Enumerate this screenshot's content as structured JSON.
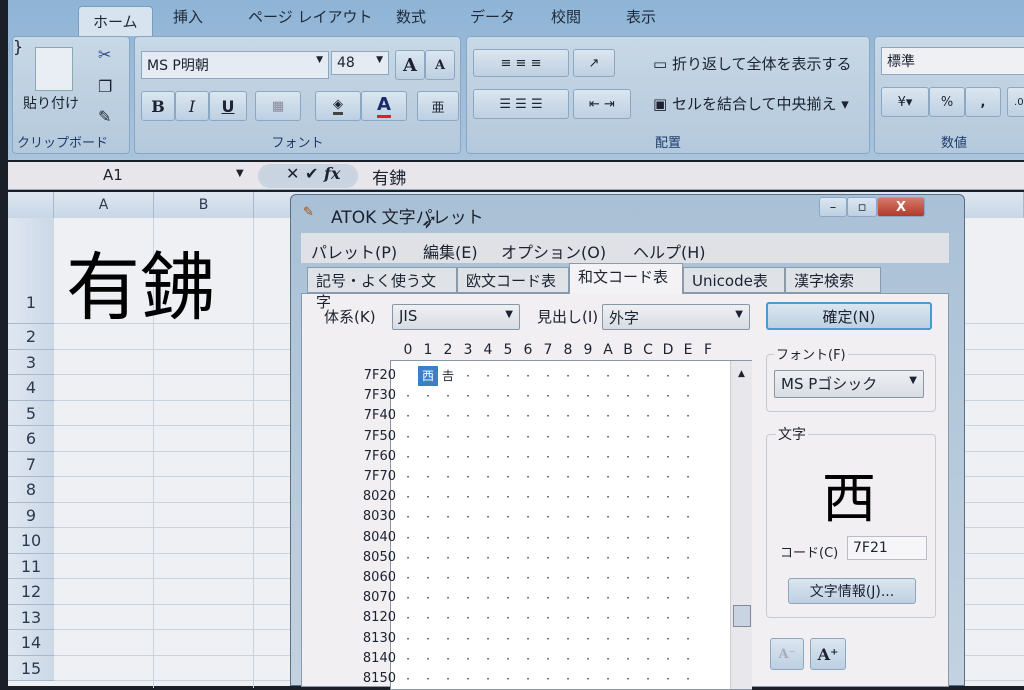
{
  "ribbon": {
    "tabs": [
      "ホーム",
      "挿入",
      "ページ レイアウト",
      "数式",
      "データ",
      "校閲",
      "表示"
    ],
    "clipboard": {
      "paste": "貼り付け",
      "label": "クリップボード"
    },
    "font": {
      "name": "MS P明朝",
      "size": "48",
      "label": "フォント",
      "bold": "B",
      "italic": "I",
      "underline": "U",
      "grow": "A",
      "shrink": "A",
      "color": "A",
      "phonetic": "亜"
    },
    "alignment": {
      "wrap": "折り返して全体を表示する",
      "merge": "セルを結合して中央揃え",
      "label": "配置"
    },
    "number": {
      "format": "標準",
      "percent": "%",
      "comma": ",",
      "label": "数値"
    }
  },
  "formula_bar": {
    "cell": "A1",
    "fx": "fx",
    "content": "有鉘"
  },
  "sheet": {
    "columns": [
      "A",
      "B"
    ],
    "rows": [
      "1",
      "2",
      "3",
      "4",
      "5",
      "6",
      "7",
      "8",
      "9",
      "10",
      "11",
      "12",
      "13",
      "14",
      "15"
    ],
    "a1": "有鉘"
  },
  "palette": {
    "title": "ATOK 文字パレット",
    "menus": [
      "パレット(P)",
      "編集(E)",
      "オプション(O)",
      "ヘルプ(H)"
    ],
    "tabs": [
      "記号・よく使う文字",
      "欧文コード表",
      "和文コード表",
      "Unicode表",
      "漢字検索"
    ],
    "system_label": "体系(K)",
    "system": "JIS",
    "heading_label": "見出し(I)",
    "heading": "外字",
    "ok": "確定(N)",
    "hex_cols": [
      "0",
      "1",
      "2",
      "3",
      "4",
      "5",
      "6",
      "7",
      "8",
      "9",
      "A",
      "B",
      "C",
      "D",
      "E",
      "F"
    ],
    "row_codes": [
      "7F20",
      "7F30",
      "7F40",
      "7F50",
      "7F60",
      "7F70",
      "8020",
      "8030",
      "8040",
      "8050",
      "8060",
      "8070",
      "8120",
      "8130",
      "8140",
      "8150"
    ],
    "glyphs": {
      "selected": "西",
      "second": "𠮷"
    },
    "font_label": "フォント(F)",
    "font": "MS Pゴシック",
    "char_label": "文字",
    "preview": "西",
    "code_label": "コード(C)",
    "code": "7F21",
    "info": "文字情報(J)...",
    "smaller": "A",
    "larger": "A"
  }
}
